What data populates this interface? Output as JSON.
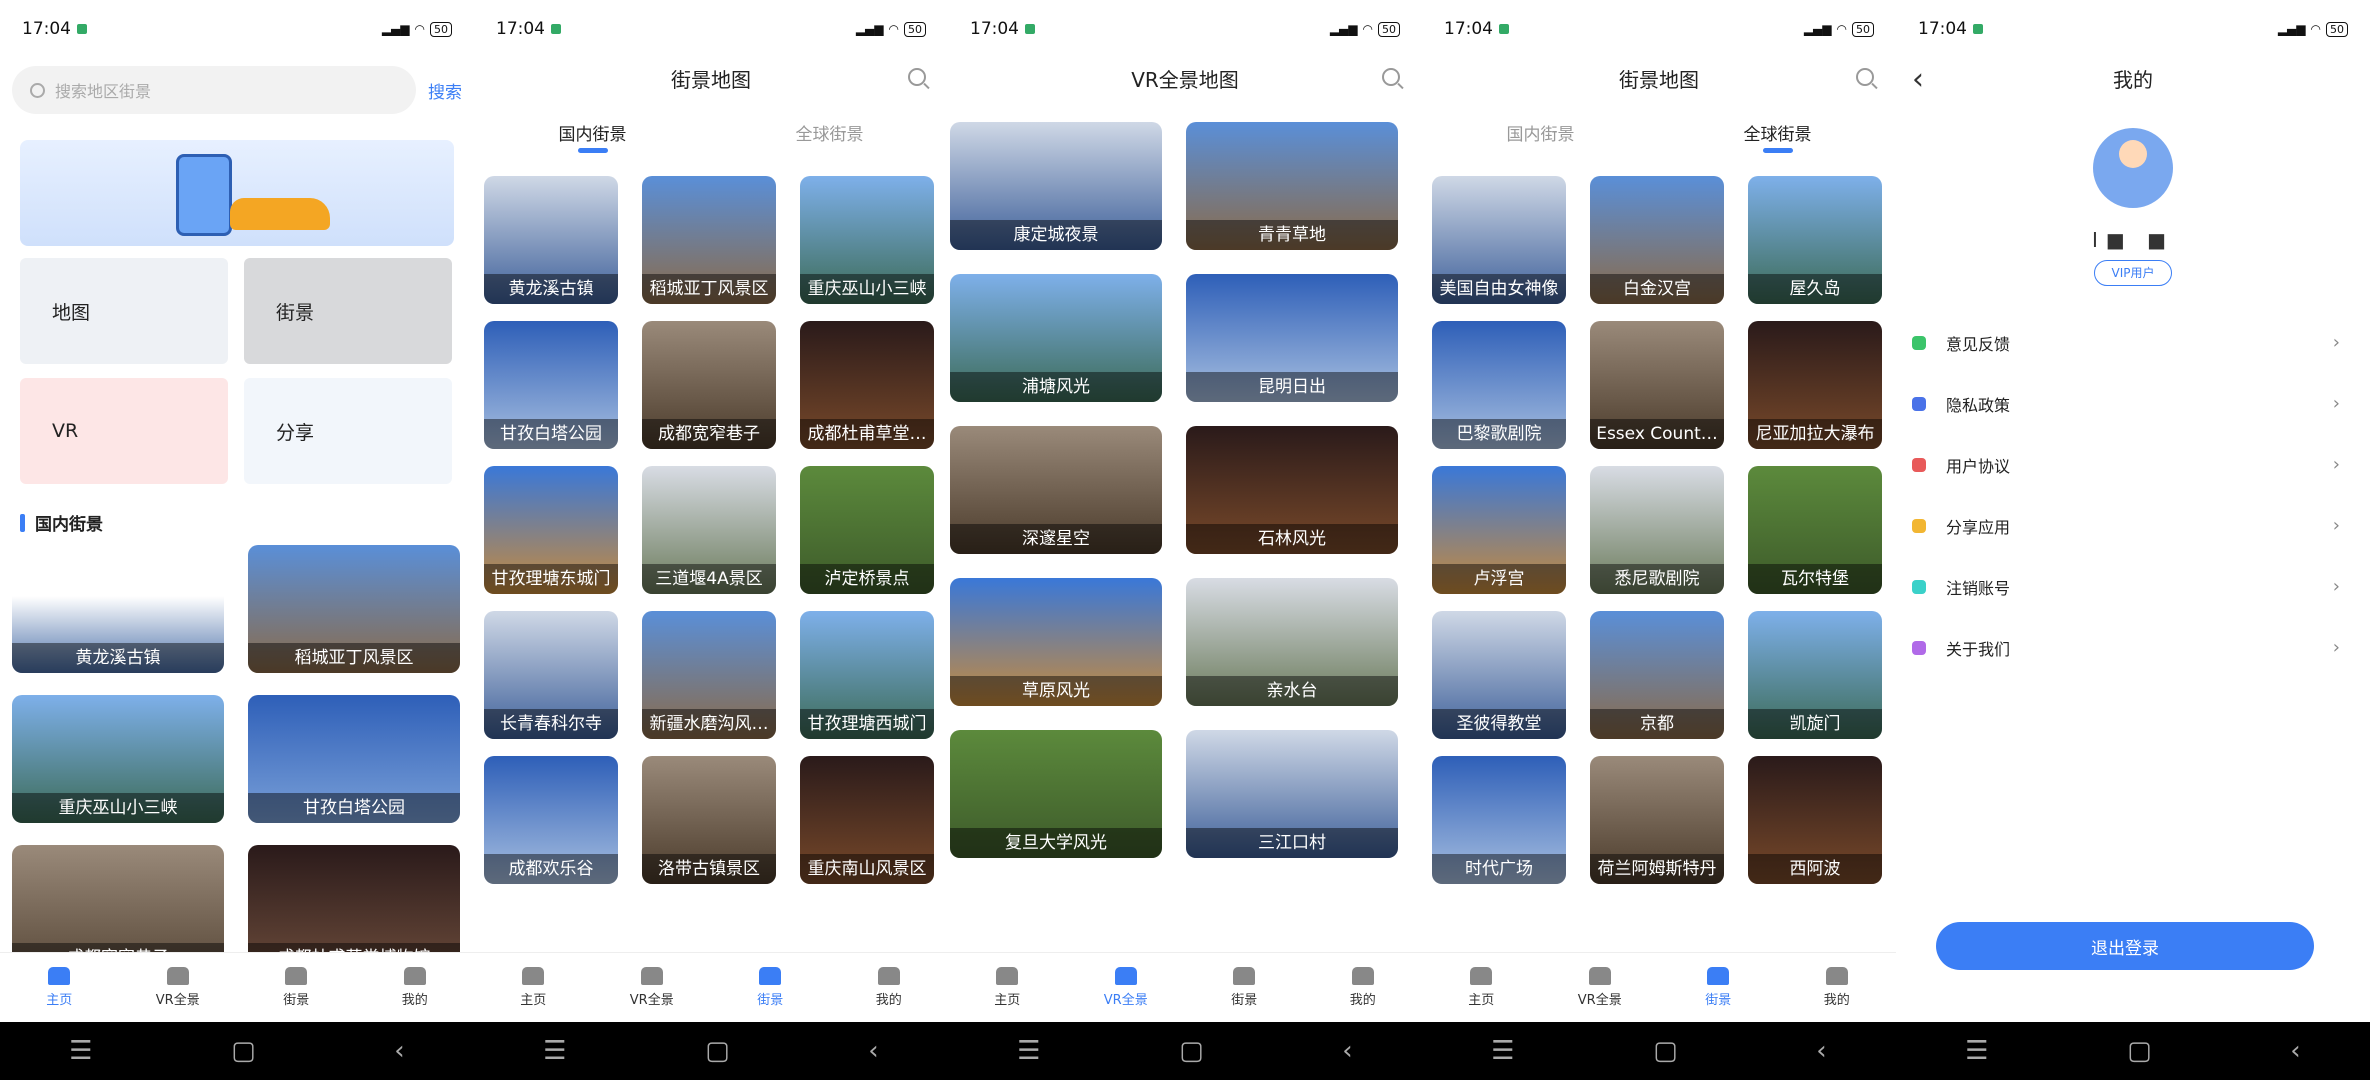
{
  "time": "17:04",
  "battery": "50",
  "home": {
    "search_placeholder": "搜索地区街景",
    "search_button": "搜索",
    "features": [
      "地图",
      "街景",
      "VR",
      "分享"
    ],
    "section_title": "国内街景",
    "cards": [
      "黄龙溪古镇",
      "稻城亚丁风景区",
      "重庆巫山小三峡",
      "甘孜白塔公园",
      "成都宽窄巷子",
      "成都杜甫草堂博物馆"
    ]
  },
  "street": {
    "title": "街景地图",
    "tabs": [
      "国内街景",
      "全球街景"
    ],
    "domestic": [
      "黄龙溪古镇",
      "稻城亚丁风景区",
      "重庆巫山小三峡",
      "甘孜白塔公园",
      "成都宽窄巷子",
      "成都杜甫草堂…",
      "甘孜理塘东城门",
      "三道堰4A景区",
      "泸定桥景点",
      "长青春科尔寺",
      "新疆水磨沟风…",
      "甘孜理塘西城门",
      "成都欢乐谷",
      "洛带古镇景区",
      "重庆南山风景区"
    ],
    "global": [
      "美国自由女神像",
      "白金汉宫",
      "屋久岛",
      "巴黎歌剧院",
      "Essex Count…",
      "尼亚加拉大瀑布",
      "卢浮宫",
      "悉尼歌剧院",
      "瓦尔特堡",
      "圣彼得教堂",
      "京都",
      "凯旋门",
      "时代广场",
      "荷兰阿姆斯特丹",
      "西阿波"
    ]
  },
  "vr": {
    "title": "VR全景地图",
    "cards": [
      "康定城夜景",
      "青青草地",
      "浦塘风光",
      "昆明日出",
      "深邃星空",
      "石林风光",
      "草原风光",
      "亲水台",
      "复旦大学风光",
      "三江口村"
    ]
  },
  "nav": [
    "主页",
    "VR全景",
    "街景",
    "我的"
  ],
  "me": {
    "title": "我的",
    "vip": "VIP用户",
    "name": "I■ ■",
    "menu": [
      "意见反馈",
      "隐私政策",
      "用户协议",
      "分享应用",
      "注销账号",
      "关于我们"
    ],
    "logout": "退出登录"
  },
  "colors": {
    "accent": "#3b7ef5"
  },
  "icons": [
    "search-icon",
    "back-icon",
    "chevron-right-icon",
    "home-icon",
    "vr-icon",
    "street-icon",
    "profile-icon"
  ]
}
